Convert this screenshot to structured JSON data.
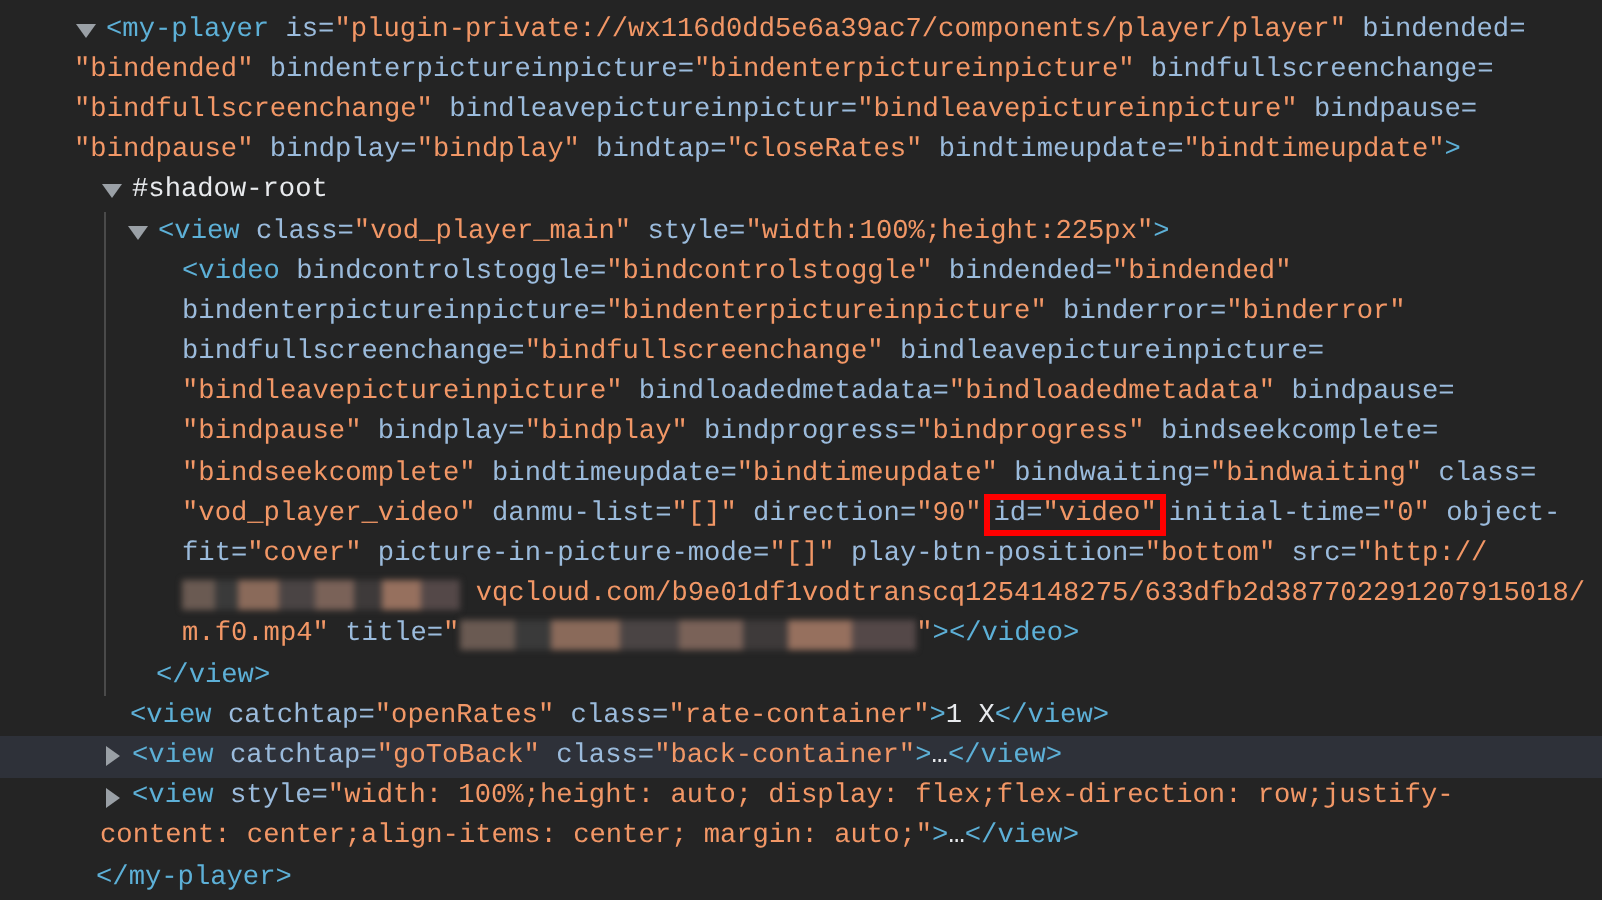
{
  "panel": {
    "nodes": [
      {
        "expanded": true,
        "selected": false,
        "lines": [
          [
            {
              "kind": "tag",
              "text": "<my-player"
            },
            {
              "kind": "attr",
              "text": " is="
            },
            {
              "kind": "value",
              "text": "\"plugin-private://wx116d0dd5e6a39ac7/components/player/player\""
            },
            {
              "kind": "attr",
              "text": " bindended="
            }
          ],
          [
            {
              "kind": "value",
              "text": "\"bindended\""
            },
            {
              "kind": "attr",
              "text": " bindenterpictureinpicture="
            },
            {
              "kind": "value",
              "text": "\"bindenterpictureinpicture\""
            },
            {
              "kind": "attr",
              "text": " bindfullscreenchange="
            }
          ],
          [
            {
              "kind": "value",
              "text": "\"bindfullscreenchange\""
            },
            {
              "kind": "attr",
              "text": " bindleavepictureinpictur="
            },
            {
              "kind": "value",
              "text": "\"bindleavepictureinpicture\""
            },
            {
              "kind": "attr",
              "text": " bindpause="
            }
          ],
          [
            {
              "kind": "value",
              "text": "\"bindpause\""
            },
            {
              "kind": "attr",
              "text": " bindplay="
            },
            {
              "kind": "value",
              "text": "\"bindplay\""
            },
            {
              "kind": "attr",
              "text": " bindtap="
            },
            {
              "kind": "value",
              "text": "\"closeRates\""
            },
            {
              "kind": "attr",
              "text": " bindtimeupdate="
            },
            {
              "kind": "value",
              "text": "\"bindtimeupdate\""
            },
            {
              "kind": "tag",
              "text": ">"
            }
          ]
        ],
        "children": [
          {
            "expanded": true,
            "selected": false,
            "lines": [
              [
                {
                  "kind": "text",
                  "text": "#shadow-root"
                }
              ]
            ],
            "children": [
              {
                "expanded": true,
                "selected": false,
                "lines": [
                  [
                    {
                      "kind": "tag",
                      "text": "<view"
                    },
                    {
                      "kind": "attr",
                      "text": " class="
                    },
                    {
                      "kind": "value",
                      "text": "\"vod_player_main\""
                    },
                    {
                      "kind": "attr",
                      "text": " style="
                    },
                    {
                      "kind": "value",
                      "text": "\"width:100%;height:225px\""
                    },
                    {
                      "kind": "tag",
                      "text": ">"
                    }
                  ]
                ],
                "children": [
                  {
                    "selected": false,
                    "lines": [
                      [
                        {
                          "kind": "tag",
                          "text": "<video"
                        },
                        {
                          "kind": "attr",
                          "text": " bindcontrolstoggle="
                        },
                        {
                          "kind": "value",
                          "text": "\"bindcontrolstoggle\""
                        },
                        {
                          "kind": "attr",
                          "text": " bindended="
                        },
                        {
                          "kind": "value",
                          "text": "\"bindended\""
                        }
                      ],
                      [
                        {
                          "kind": "attr",
                          "text": "bindenterpictureinpicture="
                        },
                        {
                          "kind": "value",
                          "text": "\"bindenterpictureinpicture\""
                        },
                        {
                          "kind": "attr",
                          "text": " binderror="
                        },
                        {
                          "kind": "value",
                          "text": "\"binderror\""
                        }
                      ],
                      [
                        {
                          "kind": "attr",
                          "text": "bindfullscreenchange="
                        },
                        {
                          "kind": "value",
                          "text": "\"bindfullscreenchange\""
                        },
                        {
                          "kind": "attr",
                          "text": " bindleavepictureinpicture="
                        }
                      ],
                      [
                        {
                          "kind": "value",
                          "text": "\"bindleavepictureinpicture\""
                        },
                        {
                          "kind": "attr",
                          "text": " bindloadedmetadata="
                        },
                        {
                          "kind": "value",
                          "text": "\"bindloadedmetadata\""
                        },
                        {
                          "kind": "attr",
                          "text": " bindpause="
                        }
                      ],
                      [
                        {
                          "kind": "value",
                          "text": "\"bindpause\""
                        },
                        {
                          "kind": "attr",
                          "text": " bindplay="
                        },
                        {
                          "kind": "value",
                          "text": "\"bindplay\""
                        },
                        {
                          "kind": "attr",
                          "text": " bindprogress="
                        },
                        {
                          "kind": "value",
                          "text": "\"bindprogress\""
                        },
                        {
                          "kind": "attr",
                          "text": " bindseekcomplete="
                        }
                      ],
                      [
                        {
                          "kind": "value",
                          "text": "\"bindseekcomplete\""
                        },
                        {
                          "kind": "attr",
                          "text": " bindtimeupdate="
                        },
                        {
                          "kind": "value",
                          "text": "\"bindtimeupdate\""
                        },
                        {
                          "kind": "attr",
                          "text": " bindwaiting="
                        },
                        {
                          "kind": "value",
                          "text": "\"bindwaiting\""
                        },
                        {
                          "kind": "attr",
                          "text": " class="
                        }
                      ],
                      [
                        {
                          "kind": "value",
                          "text": "\"vod_player_video\""
                        },
                        {
                          "kind": "attr",
                          "text": " danmu-list="
                        },
                        {
                          "kind": "value",
                          "text": "\"[]\""
                        },
                        {
                          "kind": "attr",
                          "text": " direction="
                        },
                        {
                          "kind": "value",
                          "text": "\"90\""
                        },
                        {
                          "kind": "annotation",
                          "text": "id=",
                          "value": "\"video\""
                        },
                        {
                          "kind": "attr",
                          "text": "initial-time="
                        },
                        {
                          "kind": "value",
                          "text": "\"0\""
                        },
                        {
                          "kind": "attr",
                          "text": " object-"
                        }
                      ],
                      [
                        {
                          "kind": "attr",
                          "text": "fit="
                        },
                        {
                          "kind": "value",
                          "text": "\"cover\""
                        },
                        {
                          "kind": "attr",
                          "text": " picture-in-picture-mode="
                        },
                        {
                          "kind": "value",
                          "text": "\"[]\""
                        },
                        {
                          "kind": "attr",
                          "text": " play-btn-position="
                        },
                        {
                          "kind": "value",
                          "text": "\"bottom\""
                        },
                        {
                          "kind": "attr",
                          "text": " src="
                        },
                        {
                          "kind": "value",
                          "text": "\"http://"
                        }
                      ],
                      [
                        {
                          "kind": "redacted_short"
                        },
                        {
                          "kind": "value",
                          "text": "vqcloud.com/b9e01df1vodtranscq1254148275/633dfb2d387702291207915018/"
                        }
                      ],
                      [
                        {
                          "kind": "value",
                          "text": "m.f0.mp4\""
                        },
                        {
                          "kind": "attr",
                          "text": " title="
                        },
                        {
                          "kind": "value",
                          "text": "\""
                        },
                        {
                          "kind": "redacted_long"
                        },
                        {
                          "kind": "value",
                          "text": "\""
                        },
                        {
                          "kind": "tag",
                          "text": "></video>"
                        }
                      ]
                    ]
                  }
                ],
                "close": [
                  {
                    "kind": "tag",
                    "text": "</view>"
                  }
                ]
              }
            ]
          },
          {
            "selected": false,
            "lines": [
              [
                {
                  "kind": "tag",
                  "text": "<view"
                },
                {
                  "kind": "attr",
                  "text": " catchtap="
                },
                {
                  "kind": "value",
                  "text": "\"openRates\""
                },
                {
                  "kind": "attr",
                  "text": " class="
                },
                {
                  "kind": "value",
                  "text": "\"rate-container\""
                },
                {
                  "kind": "tag",
                  "text": ">"
                },
                {
                  "kind": "text",
                  "text": "1 X"
                },
                {
                  "kind": "tag",
                  "text": "</view>"
                }
              ]
            ]
          },
          {
            "expanded": false,
            "selected": true,
            "lines": [
              [
                {
                  "kind": "tag",
                  "text": "<view"
                },
                {
                  "kind": "attr",
                  "text": " catchtap="
                },
                {
                  "kind": "value",
                  "text": "\"goToBack\""
                },
                {
                  "kind": "attr",
                  "text": " class="
                },
                {
                  "kind": "value",
                  "text": "\"back-container\""
                },
                {
                  "kind": "tag",
                  "text": ">"
                },
                {
                  "kind": "text",
                  "text": "…"
                },
                {
                  "kind": "tag",
                  "text": "</view>"
                }
              ]
            ]
          },
          {
            "expanded": false,
            "selected": false,
            "lines": [
              [
                {
                  "kind": "tag",
                  "text": "<view"
                },
                {
                  "kind": "attr",
                  "text": " style="
                },
                {
                  "kind": "value",
                  "text": "\"width: 100%;height: auto; display: flex;flex-direction: row;justify-"
                }
              ],
              [
                {
                  "kind": "value",
                  "text": "content: center;align-items: center; margin: auto;\""
                },
                {
                  "kind": "tag",
                  "text": ">"
                },
                {
                  "kind": "text",
                  "text": "…"
                },
                {
                  "kind": "tag",
                  "text": "</view>"
                }
              ]
            ]
          }
        ],
        "close": [
          {
            "kind": "tag",
            "text": "</my-player>"
          }
        ]
      }
    ]
  }
}
